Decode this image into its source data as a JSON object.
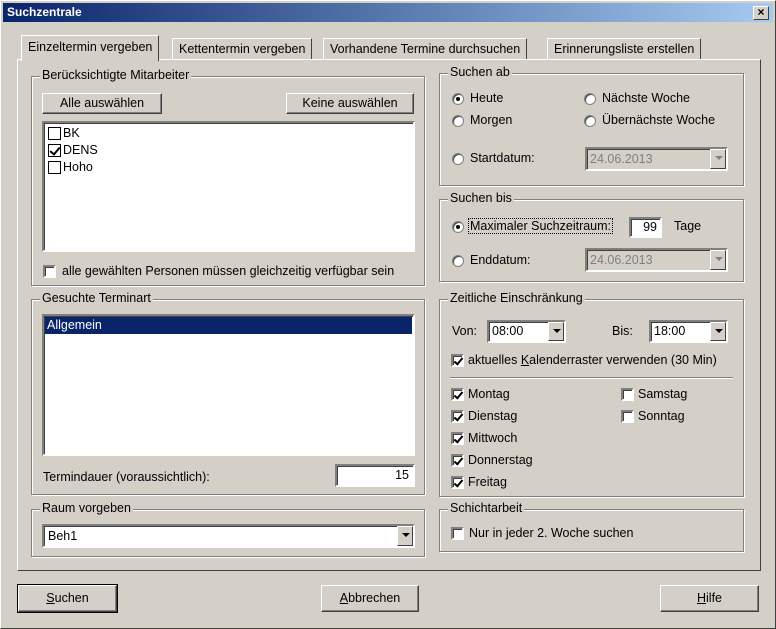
{
  "window": {
    "title": "Suchzentrale",
    "close": "×"
  },
  "tabs": [
    "Einzeltermin vergeben",
    "Kettentermin vergeben",
    "Vorhandene Termine durchsuchen",
    "Erinnerungsliste erstellen"
  ],
  "staff": {
    "legend": "Berücksichtigte Mitarbeiter",
    "select_all": "Alle auswählen",
    "select_none": "Keine auswählen",
    "items": [
      {
        "label": "BK",
        "checked": false
      },
      {
        "label": "DENS",
        "checked": true
      },
      {
        "label": "Hoho",
        "checked": false
      }
    ],
    "all_available_label": "alle gewählten Personen müssen gleichzeitig verfügbar sein",
    "all_available_checked": false
  },
  "type": {
    "legend": "Gesuchte Terminart",
    "items": [
      "Allgemein"
    ],
    "selected": "Allgemein",
    "duration_label": "Termindauer (voraussichtlich):",
    "duration_value": "15"
  },
  "room": {
    "legend": "Raum vorgeben",
    "value": "Beh1"
  },
  "search_from": {
    "legend": "Suchen ab",
    "today": "Heute",
    "tomorrow": "Morgen",
    "next_week": "Nächste Woche",
    "week_after": "Übernächste Woche",
    "start_label": "Startdatum:",
    "start_value": "24.06.2013",
    "selected": "Heute"
  },
  "search_until": {
    "legend": "Suchen bis",
    "max_label": "Maximaler Suchzeitraum:",
    "max_value": "99",
    "days": "Tage",
    "end_label": "Enddatum:",
    "end_value": "24.06.2013",
    "selected": "Maximaler Suchzeitraum:"
  },
  "time": {
    "legend": "Zeitliche Einschränkung",
    "from_label": "Von:",
    "from_value": "08:00",
    "to_label": "Bis:",
    "to_value": "18:00",
    "raster_label_pre": "aktuelles ",
    "raster_label_u": "K",
    "raster_label_post": "alenderraster verwenden (30 Min)",
    "raster_checked": true,
    "days": [
      {
        "label": "Montag",
        "checked": true
      },
      {
        "label": "Dienstag",
        "checked": true
      },
      {
        "label": "Mittwoch",
        "checked": true
      },
      {
        "label": "Donnerstag",
        "checked": true
      },
      {
        "label": "Freitag",
        "checked": true
      },
      {
        "label": "Samstag",
        "checked": false
      },
      {
        "label": "Sonntag",
        "checked": false
      }
    ]
  },
  "shift": {
    "legend": "Schichtarbeit",
    "label": "Nur in jeder 2. Woche suchen",
    "checked": false
  },
  "footer": {
    "search_u": "S",
    "search_rest": "uchen",
    "cancel_u": "A",
    "cancel_rest": "bbrechen",
    "help_u": "H",
    "help_rest": "ilfe"
  }
}
